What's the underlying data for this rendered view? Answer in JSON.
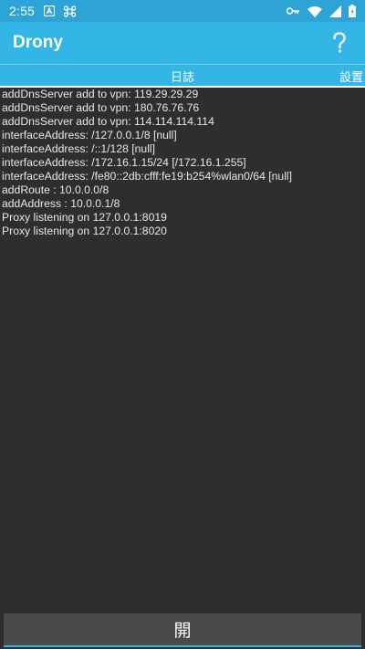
{
  "status_bar": {
    "time": "2:55",
    "left_icons": [
      "notification-a-icon",
      "command-icon"
    ],
    "right_icons": [
      "vpn-key-icon",
      "wifi-icon",
      "signal-icon",
      "battery-icon"
    ]
  },
  "app_bar": {
    "title": "Drony",
    "help_label": "?"
  },
  "tabs": [
    {
      "label": "日誌",
      "selected": true
    },
    {
      "label": "設置",
      "selected": false
    }
  ],
  "log": {
    "lines": [
      "addDnsServer add to vpn: 119.29.29.29",
      "addDnsServer add to vpn: 180.76.76.76",
      "addDnsServer add to vpn: 114.114.114.114",
      "interfaceAddress: /127.0.0.1/8 [null]",
      "interfaceAddress: /::1/128 [null]",
      "interfaceAddress: /172.16.1.15/24 [/172.16.1.255]",
      "interfaceAddress: /fe80::2db:cfff:fe19:b254%wlan0/64 [null]",
      "addRoute : 10.0.0.0/8",
      "addAddress : 10.0.0.1/8",
      "Proxy listening on 127.0.0.1:8019",
      "Proxy listening on 127.0.0.1:8020"
    ]
  },
  "bottom": {
    "button_label": "開"
  },
  "colors": {
    "status_bar": "#2ea3d6",
    "accent": "#33b5e5",
    "background": "#2e2e2e",
    "button": "#4a4a4a"
  }
}
